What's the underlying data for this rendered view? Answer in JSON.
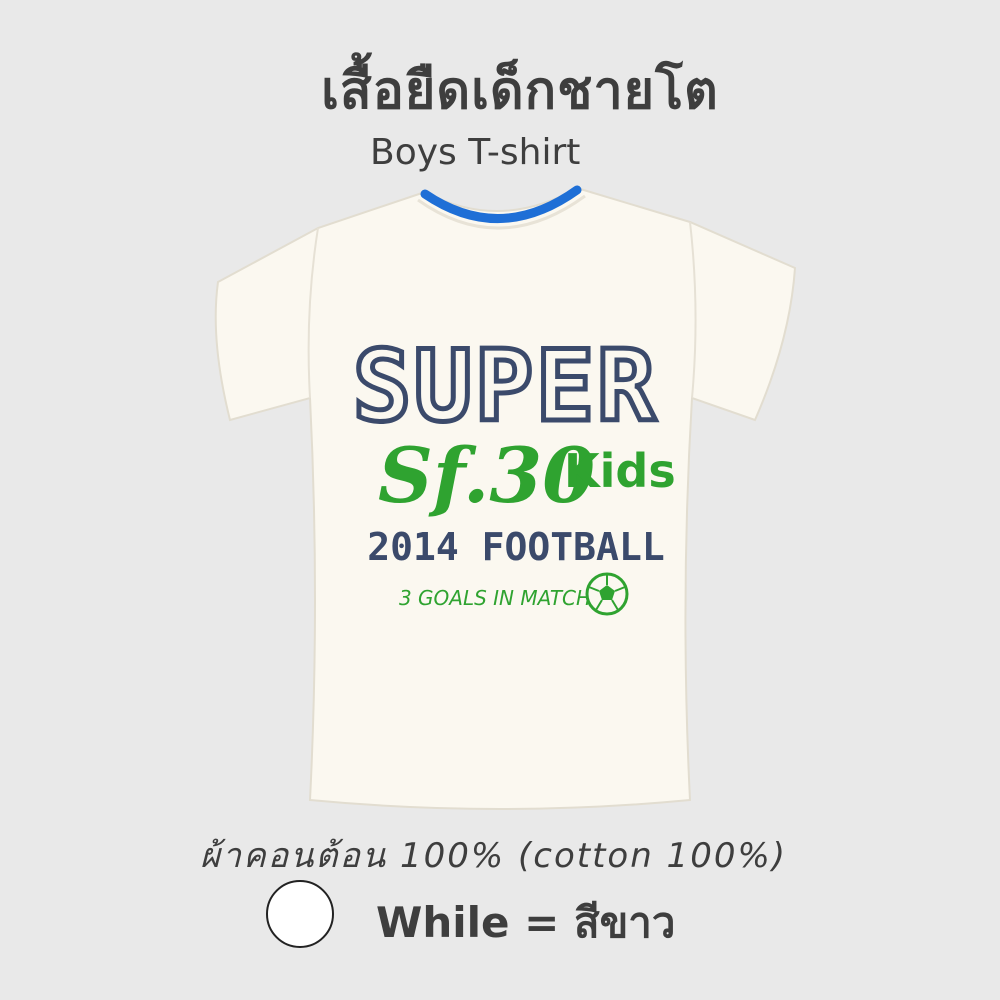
{
  "product": {
    "title_th": "เสื้อยืดเด็กชายโต",
    "title_en": "Boys T-shirt"
  },
  "shirt": {
    "body_color": "#fbf8f0",
    "collar_color": "#1f6fd6",
    "print": {
      "line1": "SUPER",
      "line2": "Sf.30",
      "line2b": "Kids",
      "line3": "2014 FOOTBALL",
      "line4": "3 GOALS IN MATCH",
      "navy": "#3b4a6b",
      "green": "#2fa330",
      "ball_icon": "soccer-ball-icon"
    }
  },
  "info": {
    "material": "ผ้าคอนต้อน 100% (cotton 100%)",
    "color_swatch": "#ffffff",
    "color_label": "While = สีขาว"
  }
}
